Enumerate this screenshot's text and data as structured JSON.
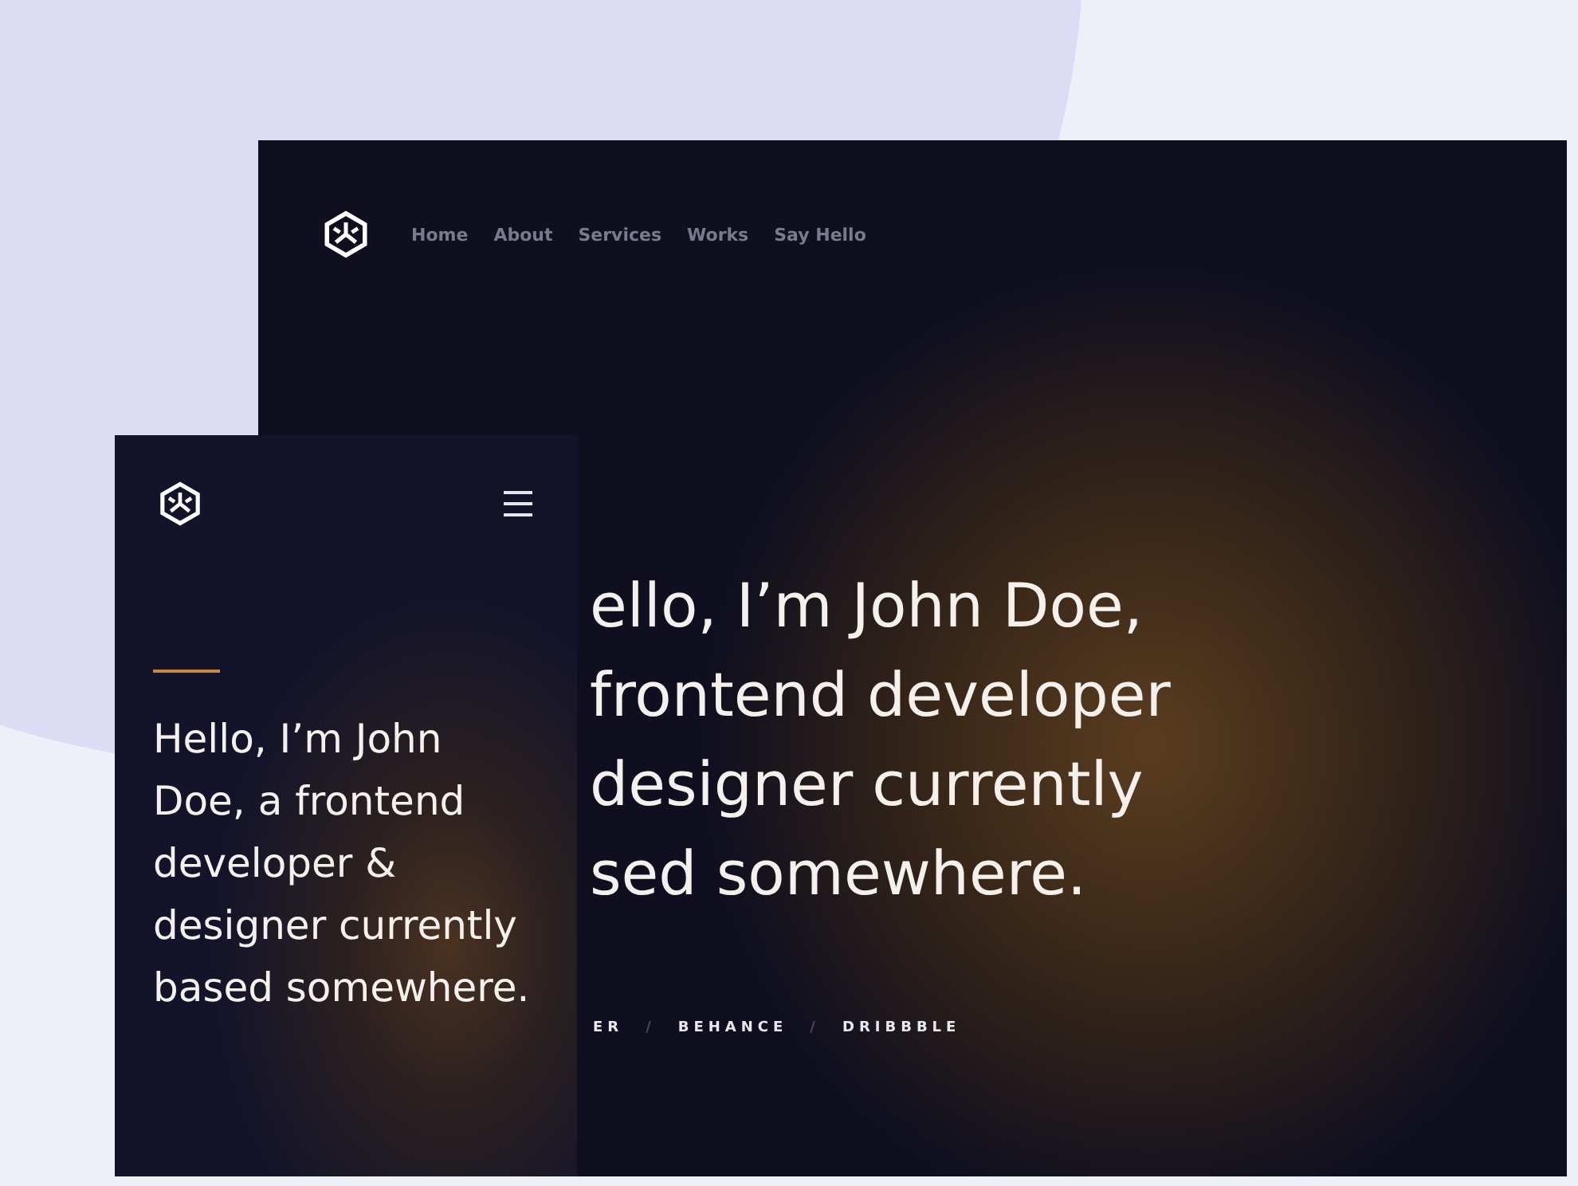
{
  "desktop": {
    "nav": [
      "Home",
      "About",
      "Services",
      "Works",
      "Say Hello"
    ],
    "headline_lines": [
      "ello, I’m John Doe,",
      "frontend developer",
      "designer currently",
      "sed somewhere."
    ],
    "social_links": [
      {
        "kind": "link",
        "text": "ER"
      },
      {
        "kind": "separator",
        "text": "/"
      },
      {
        "kind": "link",
        "text": "BEHANCE"
      },
      {
        "kind": "separator",
        "text": "/"
      },
      {
        "kind": "link",
        "text": "DRIBBBLE"
      }
    ]
  },
  "mobile": {
    "headline": "Hello, I’m John Doe, a frontend developer & designer currently based somewhere."
  }
}
